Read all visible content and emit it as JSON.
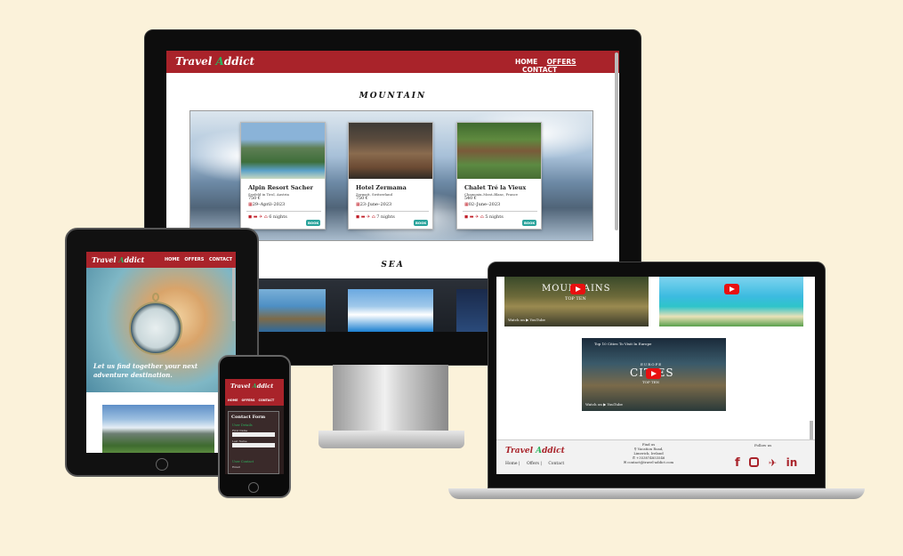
{
  "brand": {
    "word1": "Travel ",
    "a_letter": "A",
    "word2_rest": "ddict"
  },
  "nav": {
    "home": "HOME",
    "offers": "OFFERS",
    "contact": "CONTACT"
  },
  "colors": {
    "background": "#fbf2da",
    "header_red": "#a9232a",
    "teal": "#2aa39b",
    "brand_green": "#2db35e"
  },
  "desktop": {
    "section_mountain": "MOUNTAIN",
    "section_sea": "SEA",
    "hotels": [
      {
        "name": "Alpin Resort Sacher",
        "location": "Seefeld in Tirol, Austria",
        "price": "750 €",
        "date": "29–April–2023",
        "nights": "6 nights",
        "book": "BOOK"
      },
      {
        "name": "Hotel Zermama",
        "location": "Zermatt, Switzerland",
        "price": "750 €",
        "date": "23–June–2023",
        "nights": "7 nights",
        "book": "BOOK"
      },
      {
        "name": "Chalet Tré la Vieux",
        "location": "Chamonix–Mont–Blanc, France",
        "price": "540 €",
        "date": "02–June–2023",
        "nights": "5 nights",
        "book": "BOOK"
      }
    ]
  },
  "tablet": {
    "hero_text": "Let us find together your next adventure destination."
  },
  "phone": {
    "form_title": "Contact Form",
    "section_user_details": "User Details",
    "label_first_name": "First Name",
    "label_last_name": "Last Name",
    "section_user_contact": "User Contact",
    "label_email": "Email"
  },
  "laptop": {
    "video1_title": "MOUNTAINS",
    "video1_sub": "TOP TEN",
    "watch_on": "Watch on",
    "youtube": "YouTube",
    "video3_header": "Top 10 Cities To Visit In Europe",
    "video3_title_a": "EUROPE",
    "video3_title_b": "CITIES",
    "video3_title_c": "TOP TEN",
    "footer": {
      "find_us": "Find us",
      "address1": "Vacation Road,",
      "address2": "Limerick, Ireland",
      "phone": "+353874853546",
      "email": "contact@travel-addict.com",
      "follow_us": "Follow us",
      "links": [
        "Home |",
        "Offers |",
        "Contact"
      ]
    },
    "social_icons": [
      "facebook-icon",
      "instagram-icon",
      "twitter-icon",
      "linkedin-icon"
    ]
  }
}
